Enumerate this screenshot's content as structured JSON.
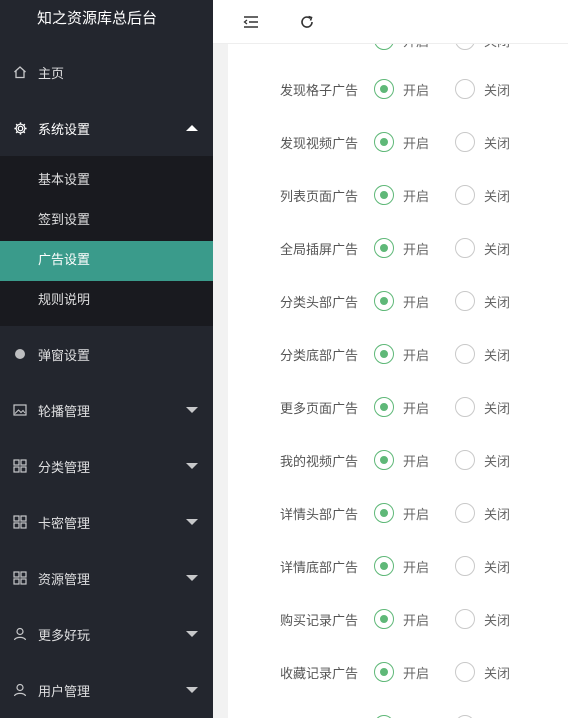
{
  "app": {
    "title": "知之资源库总后台"
  },
  "toolbar": {
    "fold_icon": "menu-fold-icon",
    "refresh_icon": "refresh-icon"
  },
  "sidebar": {
    "home": {
      "label": "主页",
      "icon": "home-icon"
    },
    "system": {
      "label": "系统设置",
      "icon": "gear-icon",
      "expanded": true,
      "children": [
        {
          "label": "基本设置",
          "selected": false
        },
        {
          "label": "签到设置",
          "selected": false
        },
        {
          "label": "广告设置",
          "selected": true
        },
        {
          "label": "规则说明",
          "selected": false
        }
      ]
    },
    "items": [
      {
        "label": "弹窗设置",
        "icon": "dot-icon",
        "has_arrow": false
      },
      {
        "label": "轮播管理",
        "icon": "image-icon",
        "has_arrow": true
      },
      {
        "label": "分类管理",
        "icon": "grid-icon",
        "has_arrow": true
      },
      {
        "label": "卡密管理",
        "icon": "grid-icon",
        "has_arrow": true
      },
      {
        "label": "资源管理",
        "icon": "grid-icon",
        "has_arrow": true
      },
      {
        "label": "更多好玩",
        "icon": "user-icon",
        "has_arrow": true
      },
      {
        "label": "用户管理",
        "icon": "user-icon",
        "has_arrow": true
      }
    ]
  },
  "form": {
    "on_label": "开启",
    "off_label": "关闭",
    "rows": [
      {
        "label": "",
        "value": "on"
      },
      {
        "label": "发现格子广告",
        "value": "on"
      },
      {
        "label": "发现视频广告",
        "value": "on"
      },
      {
        "label": "列表页面广告",
        "value": "on"
      },
      {
        "label": "全局插屏广告",
        "value": "on"
      },
      {
        "label": "分类头部广告",
        "value": "on"
      },
      {
        "label": "分类底部广告",
        "value": "on"
      },
      {
        "label": "更多页面广告",
        "value": "on"
      },
      {
        "label": "我的视频广告",
        "value": "on"
      },
      {
        "label": "详情头部广告",
        "value": "on"
      },
      {
        "label": "详情底部广告",
        "value": "on"
      },
      {
        "label": "购买记录广告",
        "value": "on"
      },
      {
        "label": "收藏记录广告",
        "value": "on"
      },
      {
        "label": "",
        "value": "on"
      }
    ]
  },
  "colors": {
    "sidebar_bg": "#23262e",
    "submenu_bg": "#191a1f",
    "selected_bg": "#3a9b8b",
    "radio_checked": "#5fb878"
  }
}
